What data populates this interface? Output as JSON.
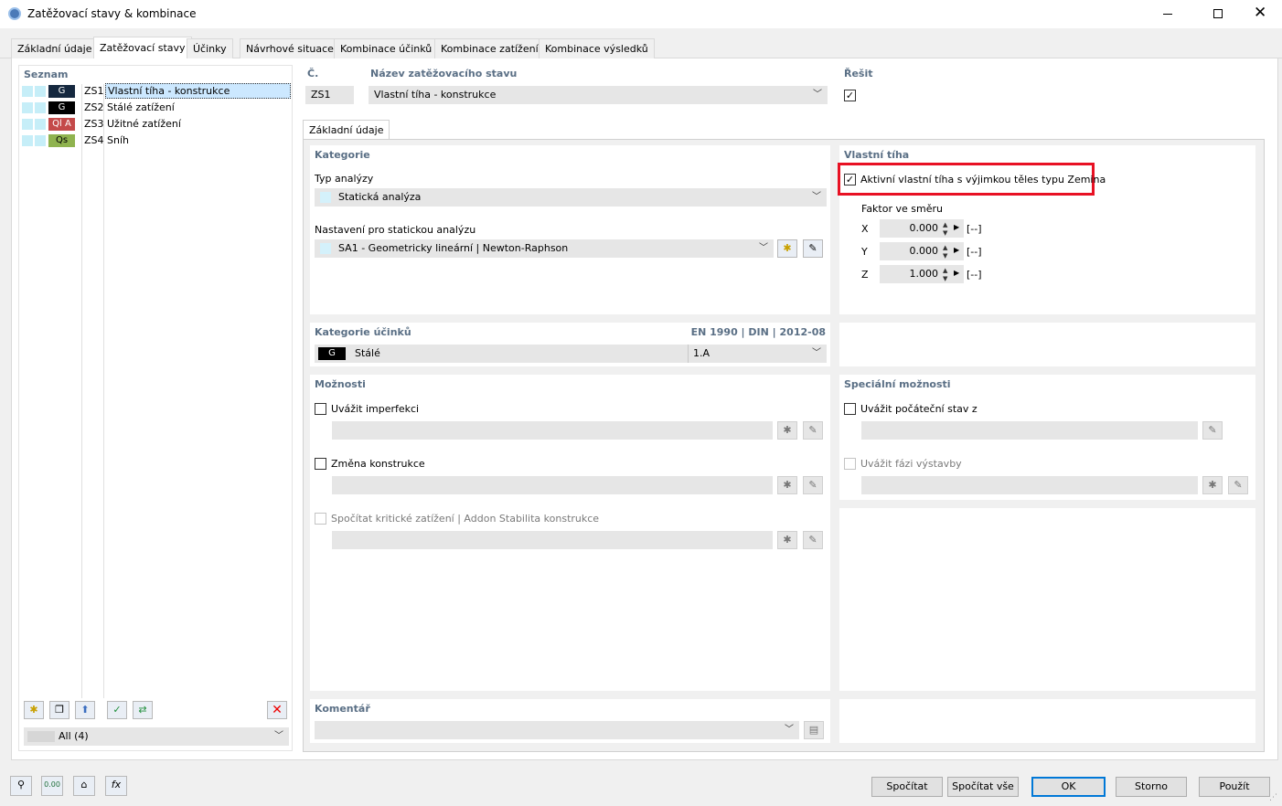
{
  "window": {
    "title": "Zatěžovací stavy & kombinace"
  },
  "tabs": [
    "Základní údaje",
    "Zatěžovací stavy",
    "Účinky",
    "Návrhové situace",
    "Kombinace účinků",
    "Kombinace zatížení",
    "Kombinace výsledků"
  ],
  "list": {
    "header": "Seznam",
    "items": [
      {
        "badge": "G",
        "id": "ZS1",
        "name": "Vlastní tíha - konstrukce",
        "badge_color": "#15283f"
      },
      {
        "badge": "G",
        "id": "ZS2",
        "name": "Stálé zatížení",
        "badge_color": "#000000"
      },
      {
        "badge": "Ql A",
        "id": "ZS3",
        "name": "Užitné zatížení",
        "badge_color": "#c44a4a"
      },
      {
        "badge": "Qs",
        "id": "ZS4",
        "name": "Sníh",
        "badge_color": "#8fb34f"
      }
    ],
    "filter": "All (4)"
  },
  "header_fields": {
    "no_label": "Č.",
    "no_value": "ZS1",
    "name_label": "Název zatěžovacího stavu",
    "name_value": "Vlastní tíha - konstrukce",
    "solve_label": "Řešit",
    "solve_checked": "✓"
  },
  "subtab": "Základní údaje",
  "category": {
    "title": "Kategorie",
    "analysis_label": "Typ analýzy",
    "analysis_value": "Statická analýza",
    "settings_label": "Nastavení pro statickou analýzu",
    "settings_value": "SA1 - Geometricky lineární | Newton-Raphson"
  },
  "selfweight": {
    "title": "Vlastní tíha",
    "active_label": "Aktivní vlastní tíha s výjimkou těles typu Zemina",
    "active_checked": "✓",
    "factor_label": "Faktor ve směru",
    "factors": [
      {
        "axis": "X",
        "value": "0.000",
        "unit": "[--]"
      },
      {
        "axis": "Y",
        "value": "0.000",
        "unit": "[--]"
      },
      {
        "axis": "Z",
        "value": "1.000",
        "unit": "[--]"
      }
    ]
  },
  "action_category": {
    "title": "Kategorie účinků",
    "standard": "EN 1990 | DIN | 2012-08",
    "badge": "G",
    "value": "Stálé",
    "code": "1.A"
  },
  "options": {
    "title": "Možnosti",
    "imperfection": "Uvážit imperfekci",
    "structure_change": "Změna konstrukce",
    "critical_load": "Spočítat kritické zatížení | Addon Stabilita konstrukce"
  },
  "special": {
    "title": "Speciální možnosti",
    "initial_state": "Uvážit počáteční stav z",
    "construction_stage": "Uvážit fázi výstavby"
  },
  "comment": {
    "title": "Komentář"
  },
  "buttons": {
    "calc": "Spočítat",
    "calc_all": "Spočítat vše",
    "ok": "OK",
    "cancel": "Storno",
    "apply": "Použít"
  },
  "colors": {
    "highlight": "#e81123",
    "accent": "#0078d7",
    "selection": "#cce8ff"
  }
}
